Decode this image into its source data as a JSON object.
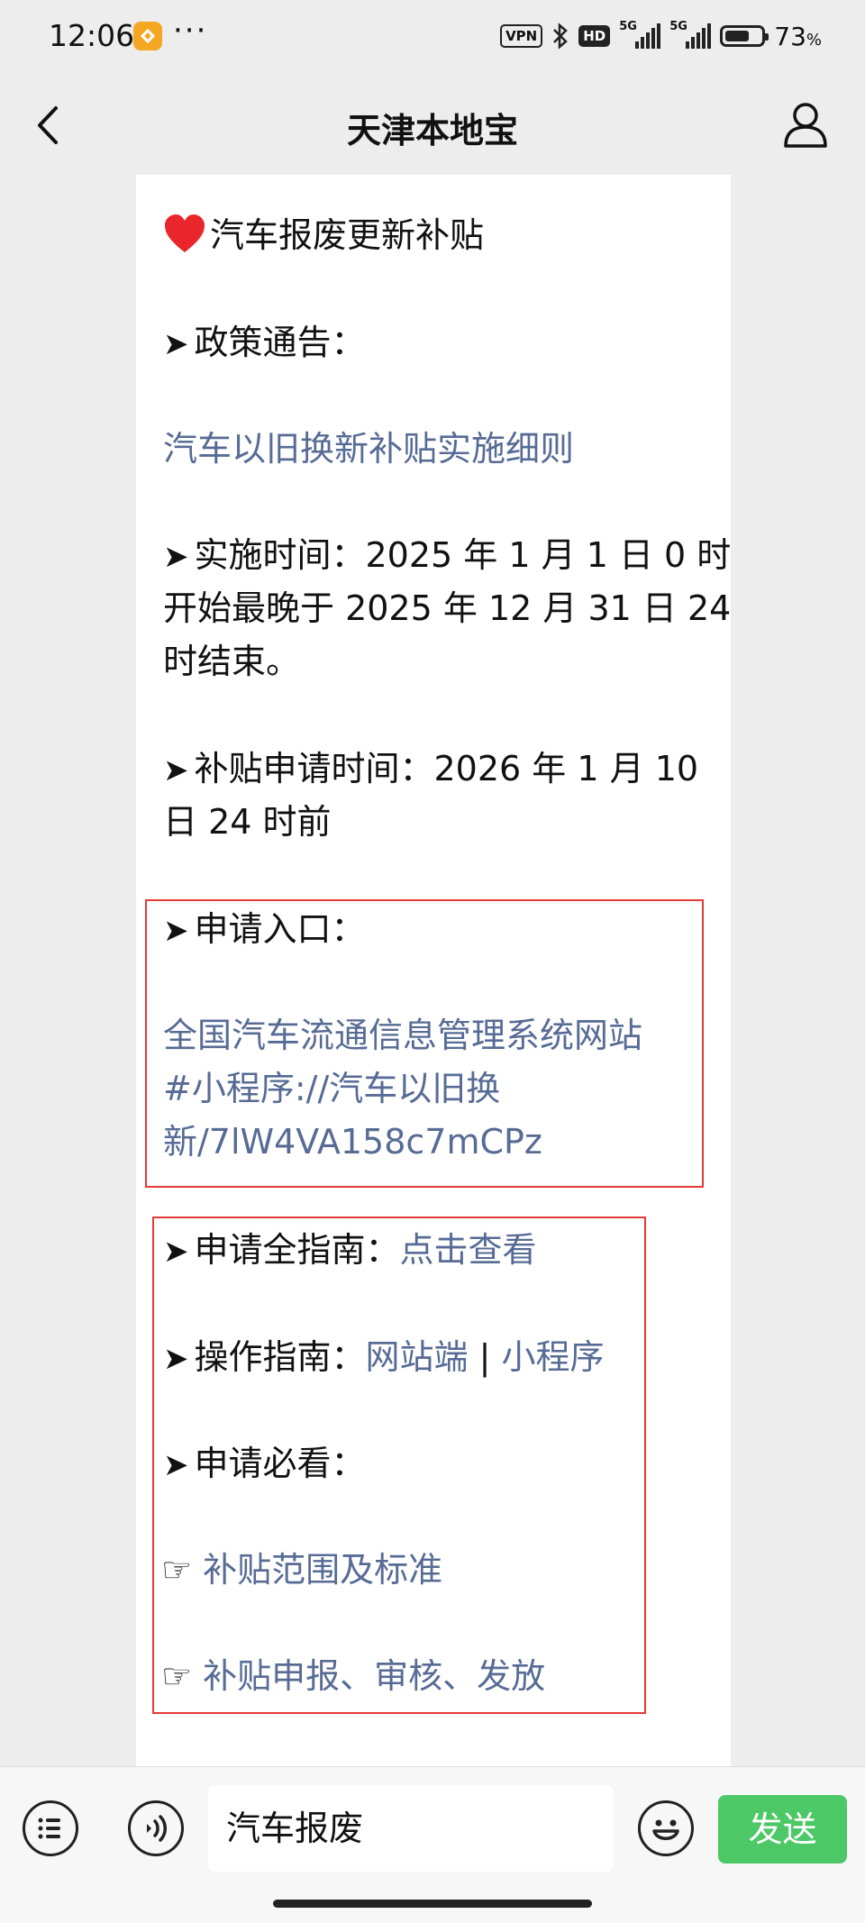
{
  "status_bar": {
    "time": "12:06",
    "more": "···",
    "vpn": "VPN",
    "hd": "HD",
    "net1": "5G",
    "net2": "5G",
    "battery_pct": "73",
    "battery_unit": "%",
    "battery_level": 0.73
  },
  "nav": {
    "title": "天津本地宝",
    "back_icon": "chevron-left-icon",
    "profile_icon": "user-icon"
  },
  "article": {
    "heading": "汽车报废更新补贴",
    "arrow": "➤",
    "hand": "☞",
    "policy_label": "政策通告：",
    "policy_link": "汽车以旧换新补贴实施细则",
    "impl_line1": "实施时间：2025 年 1 月 1 日 0 时",
    "impl_line2": "开始最晚于 2025 年 12 月 31 日 24",
    "impl_line3": "时结束。",
    "apply_line1": "补贴申请时间：2026 年 1 月 10",
    "apply_line2": "日 24 时前",
    "entry_label": "申请入口：",
    "entry_link1": "全国汽车流通信息管理系统网站",
    "entry_link2": "#小程序://汽车以旧换",
    "entry_link3": "新/7lW4VA158c7mCPz",
    "guide_label": "申请全指南：",
    "guide_link": "点击查看",
    "op_label": "操作指南：",
    "op_link_web": "网站端",
    "op_sep": "|",
    "op_link_mini": "小程序",
    "must_label": "申请必看：",
    "must_link1": "补贴范围及标准",
    "must_link2": "补贴申报、审核、发放"
  },
  "input_bar": {
    "menu_icon": "list-icon",
    "voice_icon": "voice-icon",
    "input_value": "汽车报废",
    "emoji_icon": "emoji-icon",
    "send_label": "发送"
  },
  "colors": {
    "link": "#576b95",
    "highlight_box": "#e53935",
    "send_button": "#4cc866"
  }
}
